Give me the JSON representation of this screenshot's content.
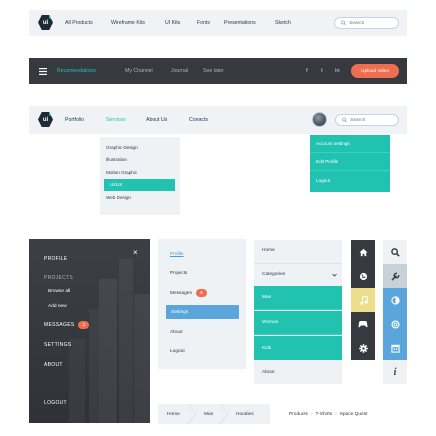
{
  "navbar1": {
    "logo_text": "ui",
    "links": [
      "All Products",
      "Wireframe Kits",
      "UI Kits",
      "Fonts",
      "Presentations",
      "Sketch"
    ],
    "search_placeholder": "Search"
  },
  "navbar2": {
    "links": [
      "Recomendations",
      "My Channel",
      "Journal",
      "See later"
    ],
    "active_link": "Recomendations",
    "social": [
      "f",
      "t",
      "in"
    ],
    "upload_label": "Upload video",
    "colors": {
      "bg": "#36393d",
      "accent": "#27c0b3",
      "upload": "#ee6f4f"
    }
  },
  "navbar3": {
    "logo_text": "ui",
    "links": [
      "Portfolio",
      "Services",
      "About Us",
      "Conacts"
    ],
    "active_link": "Services",
    "search_placeholder": "Search"
  },
  "services_dropdown": {
    "items": [
      "Graphic Design",
      "Illustration",
      "Motion Graphic",
      "UI/UX",
      "Web Design"
    ],
    "selected": "UI/UX"
  },
  "account_dropdown": {
    "items": [
      "Account settings",
      "Edit Profile",
      "Logout"
    ]
  },
  "sidebar": {
    "close_icon": "×",
    "items": [
      "PROFILE",
      "PROJECTS",
      "Browse all",
      "Add new",
      "MESSAGES",
      "SETTINGS",
      "ABOUT",
      "LOGOUT"
    ],
    "messages_badge": "3"
  },
  "menu2": {
    "items": [
      "Profile",
      "Projects",
      "Messages",
      "Settings",
      "About",
      "Logout"
    ],
    "messages_badge": "8",
    "active": "Settings"
  },
  "menu3": {
    "items": [
      "Home",
      "Categories",
      "Man",
      "Woman",
      "Kids",
      "About"
    ]
  },
  "icon_bar_dark": {
    "icons": [
      "home-icon",
      "globe-icon",
      "music-icon",
      "gamepad-icon",
      "gear-icon"
    ]
  },
  "icon_bar_light": {
    "icons": [
      "search-icon",
      "wrench-icon",
      "contrast-icon",
      "lifebuoy-icon",
      "calendar-icon",
      "info-icon"
    ],
    "info_glyph": "i"
  },
  "breadcrumb1": {
    "items": [
      "Home",
      "Man",
      "Hoodies"
    ]
  },
  "breadcrumb2": {
    "items": [
      "Products",
      "T-Shirts",
      "Space Quest"
    ],
    "separator": "›"
  }
}
